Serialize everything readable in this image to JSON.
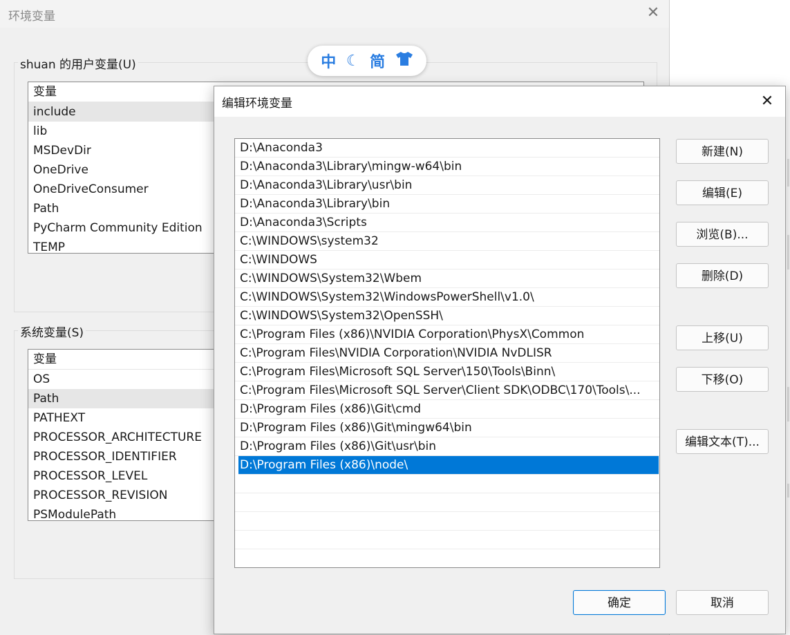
{
  "background_window": {
    "title": "环境变量",
    "close_glyph": "✕",
    "user_vars": {
      "group_label": "shuan 的用户变量(U)",
      "column_header": "变量",
      "rows": [
        "include",
        "lib",
        "MSDevDir",
        "OneDrive",
        "OneDriveConsumer",
        "Path",
        "PyCharm Community Edition",
        "TEMP"
      ],
      "selected_index": 0
    },
    "system_vars": {
      "group_label": "系统变量(S)",
      "column_header": "变量",
      "rows": [
        "OS",
        "Path",
        "PATHEXT",
        "PROCESSOR_ARCHITECTURE",
        "PROCESSOR_IDENTIFIER",
        "PROCESSOR_LEVEL",
        "PROCESSOR_REVISION",
        "PSModulePath"
      ],
      "selected_index": 1
    }
  },
  "ime_bar": {
    "mode": "中",
    "moon_icon": "☾",
    "charset": "简",
    "skin_icon": "👕"
  },
  "dialog": {
    "title": "编辑环境变量",
    "close_glyph": "✕",
    "paths": [
      "D:\\Anaconda3",
      "D:\\Anaconda3\\Library\\mingw-w64\\bin",
      "D:\\Anaconda3\\Library\\usr\\bin",
      "D:\\Anaconda3\\Library\\bin",
      "D:\\Anaconda3\\Scripts",
      "C:\\WINDOWS\\system32",
      "C:\\WINDOWS",
      "C:\\WINDOWS\\System32\\Wbem",
      "C:\\WINDOWS\\System32\\WindowsPowerShell\\v1.0\\",
      "C:\\WINDOWS\\System32\\OpenSSH\\",
      "C:\\Program Files (x86)\\NVIDIA Corporation\\PhysX\\Common",
      "C:\\Program Files\\NVIDIA Corporation\\NVIDIA NvDLISR",
      "C:\\Program Files\\Microsoft SQL Server\\150\\Tools\\Binn\\",
      "C:\\Program Files\\Microsoft SQL Server\\Client SDK\\ODBC\\170\\Tools\\...",
      "D:\\Program Files (x86)\\Git\\cmd",
      "D:\\Program Files (x86)\\Git\\mingw64\\bin",
      "D:\\Program Files (x86)\\Git\\usr\\bin",
      "D:\\Program Files (x86)\\node\\"
    ],
    "selected_index": 17,
    "buttons": {
      "new": "新建(N)",
      "edit": "编辑(E)",
      "browse": "浏览(B)...",
      "delete": "删除(D)",
      "move_up": "上移(U)",
      "move_down": "下移(O)",
      "edit_text": "编辑文本(T)...",
      "ok": "确定",
      "cancel": "取消"
    }
  }
}
